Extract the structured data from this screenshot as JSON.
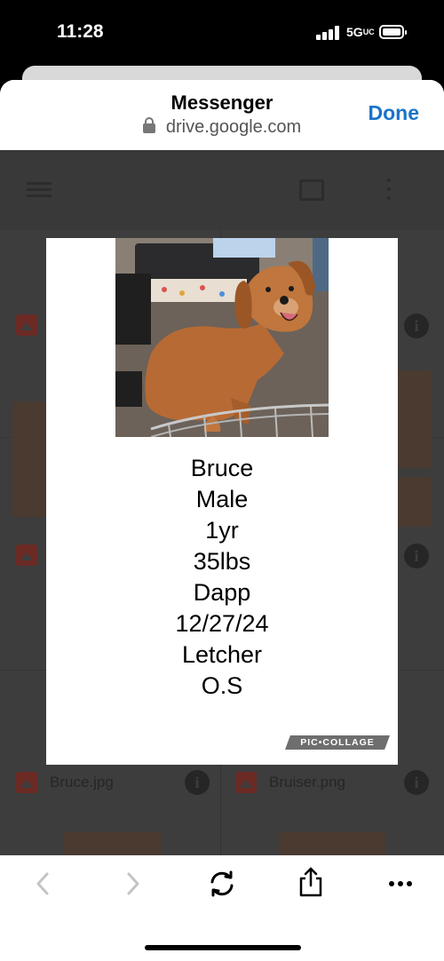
{
  "status_bar": {
    "time": "11:28",
    "network": "5GUC"
  },
  "sheet": {
    "title": "Messenger",
    "url": "drive.google.com",
    "done_label": "Done"
  },
  "drive": {
    "files": [
      {
        "name": "Bruce.jpg"
      },
      {
        "name": "Bruiser.png"
      }
    ],
    "info_glyph": "i"
  },
  "collage": {
    "lines": [
      "Bruce",
      "Male",
      "1yr",
      "35lbs",
      "Dapp",
      "12/27/24",
      "Letcher",
      "O.S"
    ],
    "watermark": "PIC•COLLAGE"
  },
  "toolbar": {
    "icons": [
      "back-icon",
      "forward-icon",
      "reload-icon",
      "share-icon",
      "more-icon"
    ]
  },
  "colors": {
    "accent": "#1a73c8",
    "overlay": "#3d3d3d"
  }
}
